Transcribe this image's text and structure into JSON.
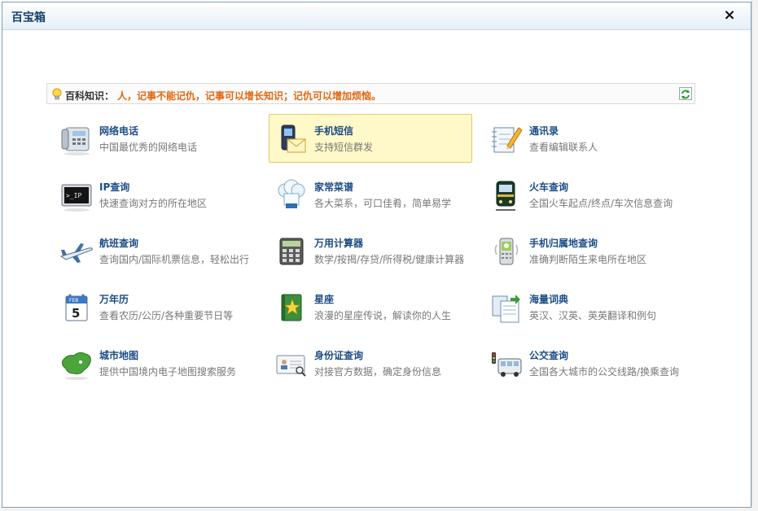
{
  "dialog": {
    "title": "百宝箱",
    "close_label": "×"
  },
  "tip": {
    "label": "百科知识：",
    "text": "人，记事不能记仇，记事可以增长知识；记仇可以增加烦恼。"
  },
  "colors": {
    "title": "#173f6b",
    "item_name": "#1c4c86",
    "tip_text": "#e1670f",
    "active_bg": "#fff8c8"
  },
  "items": [
    {
      "name": "网络电话",
      "desc": "中国最优秀的网络电话",
      "icon": "phone-icon"
    },
    {
      "name": "手机短信",
      "desc": "支持短信群发",
      "icon": "sms-icon"
    },
    {
      "name": "通讯录",
      "desc": "查看编辑联系人",
      "icon": "notebook-icon"
    },
    {
      "name": "IP查询",
      "desc": "快速查询对方的所在地区",
      "icon": "terminal-icon"
    },
    {
      "name": "家常菜谱",
      "desc": "各大菜系，可口佳肴，简单易学",
      "icon": "chef-icon"
    },
    {
      "name": "火车查询",
      "desc": "全国火车起点/终点/车次信息查询",
      "icon": "train-icon"
    },
    {
      "name": "航班查询",
      "desc": "查询国内/国际机票信息，轻松出行",
      "icon": "airplane-icon"
    },
    {
      "name": "万用计算器",
      "desc": "数学/按揭/存贷/所得税/健康计算器",
      "icon": "calculator-icon"
    },
    {
      "name": "手机归属地查询",
      "desc": "准确判断陌生来电所在地区",
      "icon": "mobile-icon"
    },
    {
      "name": "万年历",
      "desc": "查看农历/公历/各种重要节日等",
      "icon": "calendar-icon"
    },
    {
      "name": "星座",
      "desc": "浪漫的星座传说，解读你的人生",
      "icon": "star-book-icon"
    },
    {
      "name": "海量词典",
      "desc": "英汉、汉英、英英翻译和例句",
      "icon": "dictionary-icon"
    },
    {
      "name": "城市地图",
      "desc": "提供中国境内电子地图搜索服务",
      "icon": "china-map-icon"
    },
    {
      "name": "身份证查询",
      "desc": "对接官方数据，确定身份信息",
      "icon": "id-card-icon"
    },
    {
      "name": "公交查询",
      "desc": "全国各大城市的公交线路/换乘查询",
      "icon": "bus-icon"
    }
  ]
}
